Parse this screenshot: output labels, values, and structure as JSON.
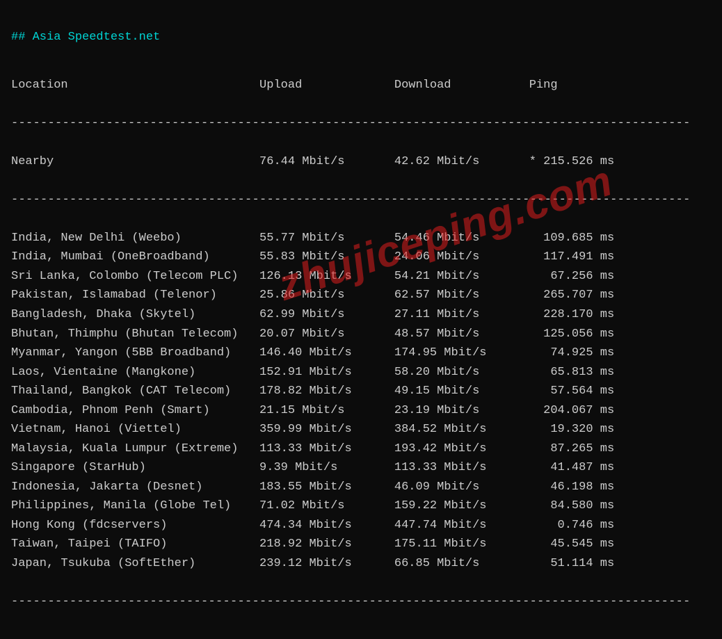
{
  "title": "## Asia Speedtest.net",
  "headers": {
    "location": "Location",
    "upload": "Upload",
    "download": "Download",
    "ping": "Ping"
  },
  "dash_line": "---------------------------------------------------------------------------------------------",
  "nearby": {
    "location": "Nearby",
    "upload": "76.44 Mbit/s",
    "download": "42.62 Mbit/s",
    "ping": "* 215.526 ms"
  },
  "rows": [
    {
      "location": "India, New Delhi (Weebo)",
      "upload": "55.77 Mbit/s",
      "download": "54.46 Mbit/s",
      "ping": "109.685 ms"
    },
    {
      "location": "India, Mumbai (OneBroadband)",
      "upload": "55.83 Mbit/s",
      "download": "24.06 Mbit/s",
      "ping": "117.491 ms"
    },
    {
      "location": "Sri Lanka, Colombo (Telecom PLC)",
      "upload": "126.13 Mbit/s",
      "download": "54.21 Mbit/s",
      "ping": "67.256 ms"
    },
    {
      "location": "Pakistan, Islamabad (Telenor)",
      "upload": "25.86 Mbit/s",
      "download": "62.57 Mbit/s",
      "ping": "265.707 ms"
    },
    {
      "location": "Bangladesh, Dhaka (Skytel)",
      "upload": "62.99 Mbit/s",
      "download": "27.11 Mbit/s",
      "ping": "228.170 ms"
    },
    {
      "location": "Bhutan, Thimphu (Bhutan Telecom)",
      "upload": "20.07 Mbit/s",
      "download": "48.57 Mbit/s",
      "ping": "125.056 ms"
    },
    {
      "location": "Myanmar, Yangon (5BB Broadband)",
      "upload": "146.40 Mbit/s",
      "download": "174.95 Mbit/s",
      "ping": "74.925 ms"
    },
    {
      "location": "Laos, Vientaine (Mangkone)",
      "upload": "152.91 Mbit/s",
      "download": "58.20 Mbit/s",
      "ping": "65.813 ms"
    },
    {
      "location": "Thailand, Bangkok (CAT Telecom)",
      "upload": "178.82 Mbit/s",
      "download": "49.15 Mbit/s",
      "ping": "57.564 ms"
    },
    {
      "location": "Cambodia, Phnom Penh (Smart)",
      "upload": "21.15 Mbit/s",
      "download": "23.19 Mbit/s",
      "ping": "204.067 ms"
    },
    {
      "location": "Vietnam, Hanoi (Viettel)",
      "upload": "359.99 Mbit/s",
      "download": "384.52 Mbit/s",
      "ping": "19.320 ms"
    },
    {
      "location": "Malaysia, Kuala Lumpur (Extreme)",
      "upload": "113.33 Mbit/s",
      "download": "193.42 Mbit/s",
      "ping": "87.265 ms"
    },
    {
      "location": "Singapore (StarHub)",
      "upload": "9.39 Mbit/s",
      "download": "113.33 Mbit/s",
      "ping": "41.487 ms"
    },
    {
      "location": "Indonesia, Jakarta (Desnet)",
      "upload": "183.55 Mbit/s",
      "download": "46.09 Mbit/s",
      "ping": "46.198 ms"
    },
    {
      "location": "Philippines, Manila (Globe Tel)",
      "upload": "71.02 Mbit/s",
      "download": "159.22 Mbit/s",
      "ping": "84.580 ms"
    },
    {
      "location": "Hong Kong (fdcservers)",
      "upload": "474.34 Mbit/s",
      "download": "447.74 Mbit/s",
      "ping": "0.746 ms"
    },
    {
      "location": "Taiwan, Taipei (TAIFO)",
      "upload": "218.92 Mbit/s",
      "download": "175.11 Mbit/s",
      "ping": "45.545 ms"
    },
    {
      "location": "Japan, Tsukuba (SoftEther)",
      "upload": "239.12 Mbit/s",
      "download": "66.85 Mbit/s",
      "ping": "51.114 ms"
    }
  ],
  "watermark": "zhujiceping.com",
  "cols": {
    "loc_width": 35,
    "up_width": 19,
    "down_width": 19,
    "ping_width": 12
  }
}
